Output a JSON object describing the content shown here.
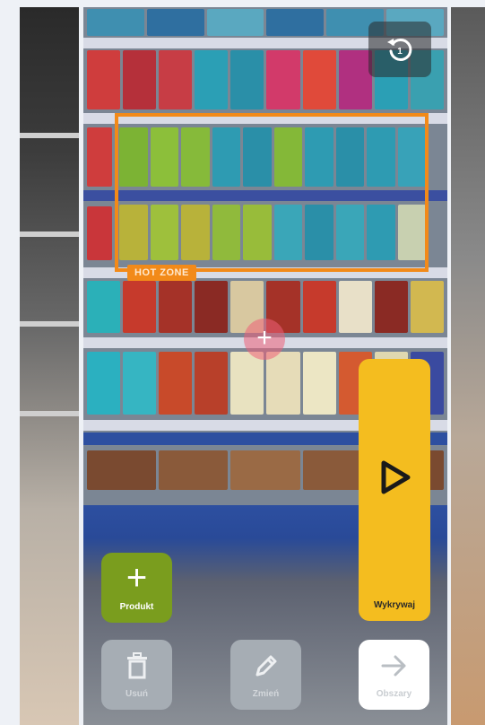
{
  "overlay": {
    "hot_zone_label": "HOT ZONE"
  },
  "buttons": {
    "detect_label": "Wykrywaj",
    "add_product_label": "Produkt",
    "delete_label": "Usuń",
    "edit_label": "Zmień",
    "areas_label": "Obszary"
  },
  "icons": {
    "undo": "rotate-ccw-icon",
    "play": "play-icon",
    "plus": "plus-icon",
    "trash": "trash-icon",
    "pencil": "pencil-icon",
    "arrow": "arrow-right-icon",
    "crosshair": "crosshair-plus-icon"
  },
  "colors": {
    "hot_zone": "#f28a19",
    "detect_button": "#f4bd1f",
    "product_button": "#7a9d1e",
    "disabled_button": "#a6adb4"
  }
}
